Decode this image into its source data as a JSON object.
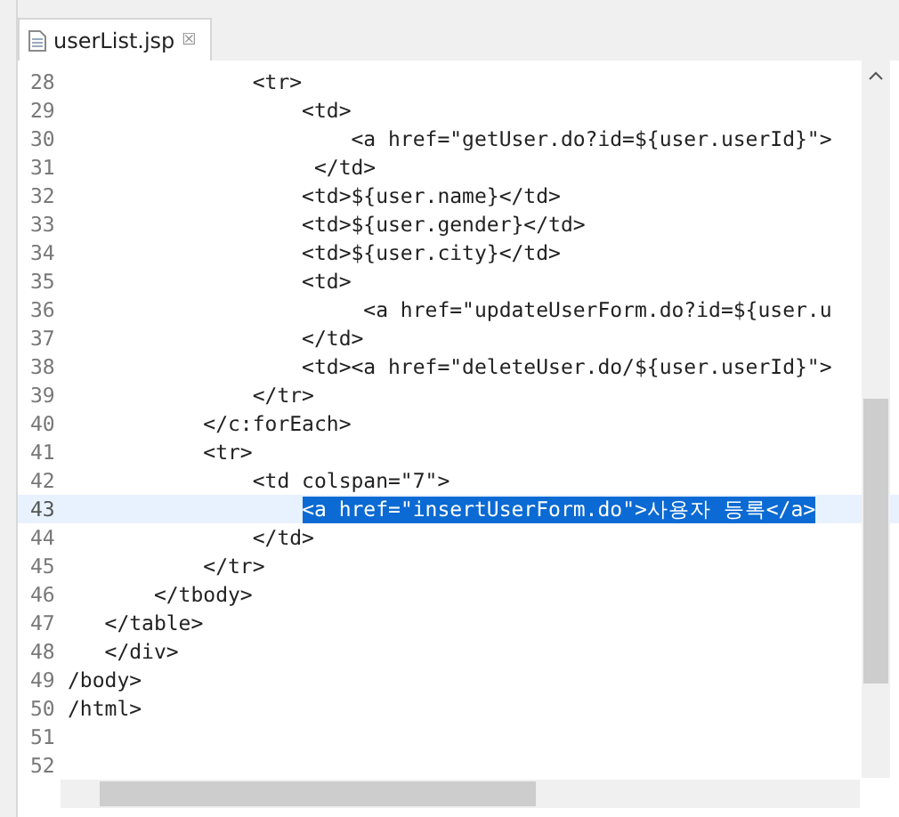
{
  "tab": {
    "label": "userList.jsp",
    "close_glyph": "☒"
  },
  "lines": [
    {
      "number": "28",
      "text": "               <tr>",
      "current": false,
      "selected": false
    },
    {
      "number": "29",
      "text": "                   <td>",
      "current": false,
      "selected": false
    },
    {
      "number": "30",
      "text": "                       <a href=\"getUser.do?id=${user.userId}\">",
      "current": false,
      "selected": false
    },
    {
      "number": "31",
      "text": "                    </td>",
      "current": false,
      "selected": false
    },
    {
      "number": "32",
      "text": "                   <td>${user.name}</td>",
      "current": false,
      "selected": false
    },
    {
      "number": "33",
      "text": "                   <td>${user.gender}</td>",
      "current": false,
      "selected": false
    },
    {
      "number": "34",
      "text": "                   <td>${user.city}</td>",
      "current": false,
      "selected": false
    },
    {
      "number": "35",
      "text": "                   <td>",
      "current": false,
      "selected": false
    },
    {
      "number": "36",
      "text": "                        <a href=\"updateUserForm.do?id=${user.u",
      "current": false,
      "selected": false
    },
    {
      "number": "37",
      "text": "                   </td>",
      "current": false,
      "selected": false
    },
    {
      "number": "38",
      "text": "                   <td><a href=\"deleteUser.do/${user.userId}\">",
      "current": false,
      "selected": false
    },
    {
      "number": "39",
      "text": "               </tr>",
      "current": false,
      "selected": false
    },
    {
      "number": "40",
      "text": "           </c:forEach>",
      "current": false,
      "selected": false
    },
    {
      "number": "41",
      "text": "           <tr>",
      "current": false,
      "selected": false
    },
    {
      "number": "42",
      "text": "               <td colspan=\"7\">",
      "current": false,
      "selected": false
    },
    {
      "number": "43",
      "text": "                   <a href=\"insertUserForm.do\">사용자 등록</a>",
      "current": true,
      "selected": true
    },
    {
      "number": "44",
      "text": "               </td>",
      "current": false,
      "selected": false
    },
    {
      "number": "45",
      "text": "           </tr>",
      "current": false,
      "selected": false
    },
    {
      "number": "46",
      "text": "       </tbody>",
      "current": false,
      "selected": false
    },
    {
      "number": "47",
      "text": "   </table>",
      "current": false,
      "selected": false
    },
    {
      "number": "48",
      "text": "   </div>",
      "current": false,
      "selected": false
    },
    {
      "number": "49",
      "text": "/body>",
      "current": false,
      "selected": false
    },
    {
      "number": "50",
      "text": "/html>",
      "current": false,
      "selected": false
    },
    {
      "number": "51",
      "current": false,
      "selected": false
    },
    {
      "number": "52",
      "current": false,
      "selected": false
    }
  ]
}
